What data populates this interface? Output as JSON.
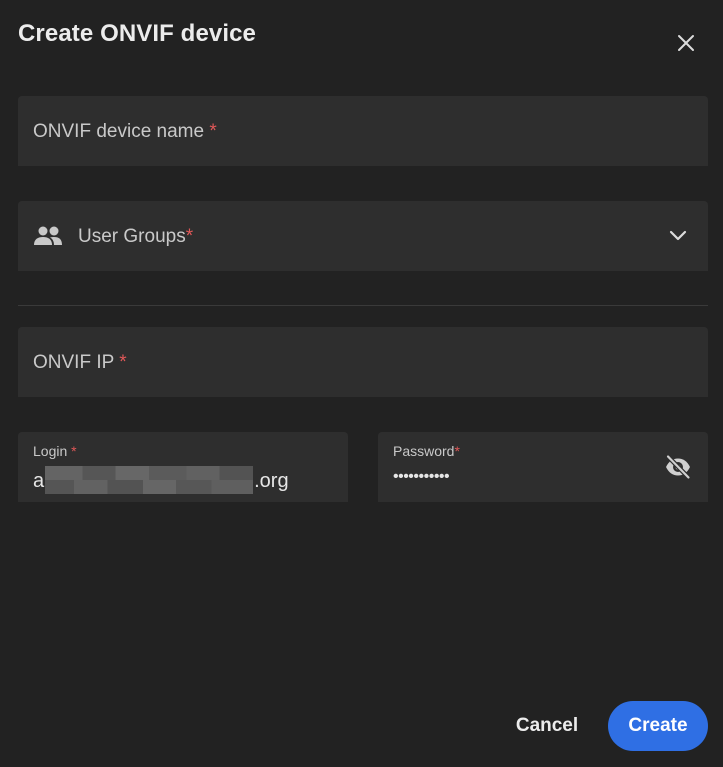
{
  "dialog": {
    "title": "Create ONVIF device",
    "close_icon": "close-icon"
  },
  "form": {
    "device_name": {
      "label": "ONVIF device name",
      "required_mark": "*"
    },
    "user_groups": {
      "label": "User Groups",
      "required_mark": "*",
      "icon": "users-icon",
      "dropdown_icon": "chevron-down-icon"
    },
    "onvif_ip": {
      "label": "ONVIF IP",
      "required_mark": "*"
    },
    "login": {
      "label": "Login",
      "required_mark": "*",
      "value_prefix": "a",
      "value_suffix": ".org"
    },
    "password": {
      "label": "Password",
      "required_mark": "*",
      "value": "•••••••••••",
      "toggle_icon": "eye-off-icon"
    }
  },
  "actions": {
    "cancel_label": "Cancel",
    "create_label": "Create"
  },
  "colors": {
    "background": "#222222",
    "field_background": "#2e2e2e",
    "accent": "#2f6fe4",
    "required": "#e05858"
  }
}
